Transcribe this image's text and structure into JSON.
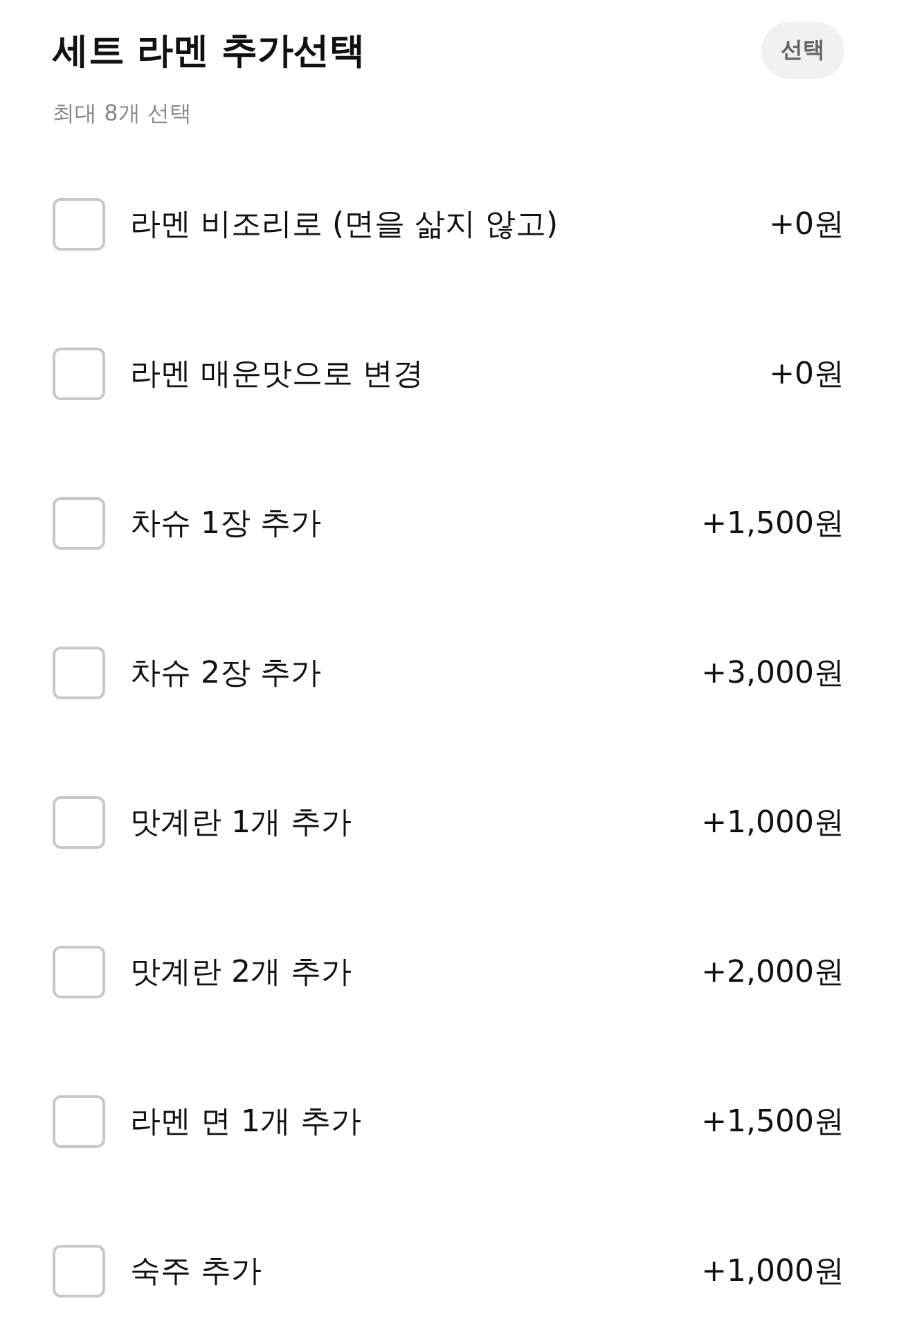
{
  "header": {
    "title": "세트 라멘 추가선택",
    "badge": "선택",
    "subtitle": "최대 8개 선택"
  },
  "options": [
    {
      "label": "라멘 비조리로 (면을 삶지 않고)",
      "price": "+0원",
      "checked": false
    },
    {
      "label": "라멘 매운맛으로 변경",
      "price": "+0원",
      "checked": false
    },
    {
      "label": "차슈 1장 추가",
      "price": "+1,500원",
      "checked": false
    },
    {
      "label": "차슈 2장 추가",
      "price": "+3,000원",
      "checked": false
    },
    {
      "label": "맛계란 1개 추가",
      "price": "+1,000원",
      "checked": false
    },
    {
      "label": "맛계란 2개 추가",
      "price": "+2,000원",
      "checked": false
    },
    {
      "label": "라멘 면 1개 추가",
      "price": "+1,500원",
      "checked": false
    },
    {
      "label": "숙주 추가",
      "price": "+1,000원",
      "checked": false
    }
  ]
}
